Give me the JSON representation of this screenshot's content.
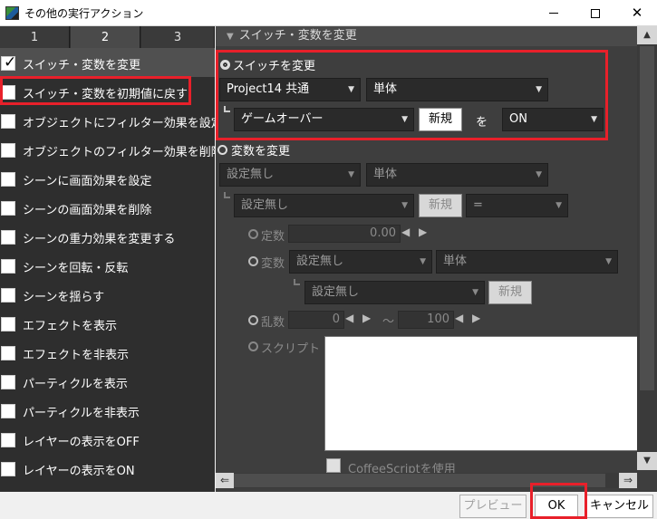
{
  "window": {
    "title": "その他の実行アクション",
    "minimize_glyph": "",
    "close_glyph": "✕"
  },
  "tabs": [
    {
      "label": "1",
      "active": false
    },
    {
      "label": "2",
      "active": true
    },
    {
      "label": "3",
      "active": false
    }
  ],
  "actions": [
    {
      "label": "スイッチ・変数を変更",
      "checked": true
    },
    {
      "label": "スイッチ・変数を初期値に戻す",
      "checked": false
    },
    {
      "label": "オブジェクトにフィルター効果を設定",
      "checked": false
    },
    {
      "label": "オブジェクトのフィルター効果を削除",
      "checked": false
    },
    {
      "label": "シーンに画面効果を設定",
      "checked": false
    },
    {
      "label": "シーンの画面効果を削除",
      "checked": false
    },
    {
      "label": "シーンの重力効果を変更する",
      "checked": false
    },
    {
      "label": "シーンを回転・反転",
      "checked": false
    },
    {
      "label": "シーンを揺らす",
      "checked": false
    },
    {
      "label": "エフェクトを表示",
      "checked": false
    },
    {
      "label": "エフェクトを非表示",
      "checked": false
    },
    {
      "label": "パーティクルを表示",
      "checked": false
    },
    {
      "label": "パーティクルを非表示",
      "checked": false
    },
    {
      "label": "レイヤーの表示をOFF",
      "checked": false
    },
    {
      "label": "レイヤーの表示をON",
      "checked": false
    }
  ],
  "section_title": "スイッチ・変数を変更",
  "switch_section": {
    "radio_label": "スイッチを変更",
    "project_select": "Project14 共通",
    "scope_select": "単体",
    "switch_select": "ゲームオーバー",
    "new_button": "新規",
    "to_label": "を",
    "value_select": "ON"
  },
  "variable_section": {
    "radio_label": "変数を変更",
    "project_select": "設定無し",
    "scope_select": "単体",
    "variable_select": "設定無し",
    "new_button": "新規",
    "operator_select": "=",
    "constant_label": "定数",
    "constant_value": "0.00",
    "variable_label": "変数",
    "var_project_select": "設定無し",
    "var_scope_select": "単体",
    "var_variable_select": "設定無し",
    "var_new_button": "新規",
    "random_label": "乱数",
    "random_min": "0",
    "random_tilde": "〜",
    "random_max": "100",
    "script_label": "スクリプト",
    "coffeescript_label": "CoffeeScriptを使用"
  },
  "footer": {
    "preview": "プレビュー",
    "ok": "OK",
    "cancel": "キャンセル"
  },
  "colors": {
    "highlight": "#e8202a",
    "panel_dark": "#2e2e2e",
    "panel_mid": "#3e3e3e"
  }
}
